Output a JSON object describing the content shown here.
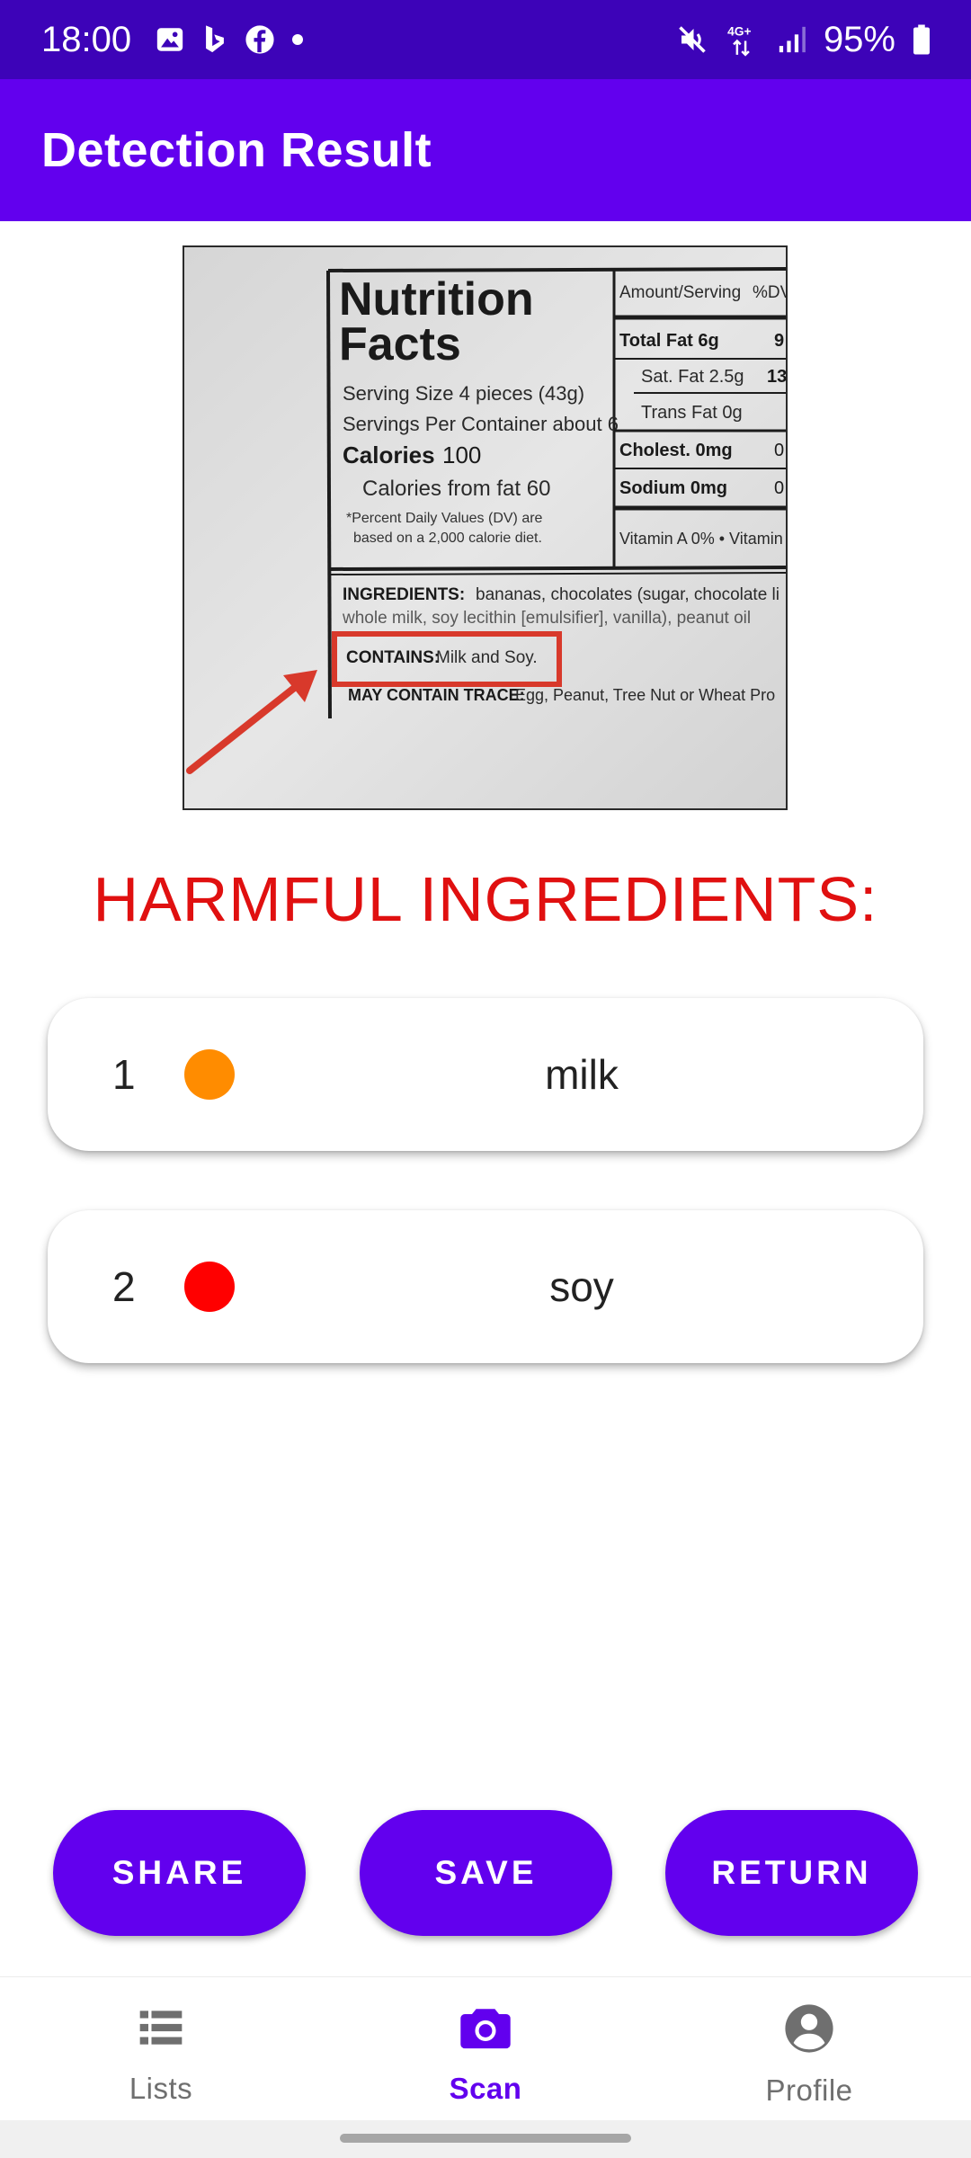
{
  "status_bar": {
    "time": "18:00",
    "battery": "95%",
    "network": "4G+",
    "left_icons": [
      "gallery-icon",
      "bing-icon",
      "facebook-icon",
      "dot-icon"
    ],
    "right_icons": [
      "mute-icon",
      "network-4g-icon",
      "signal-icon",
      "battery-icon"
    ]
  },
  "app_bar": {
    "title": "Detection Result"
  },
  "label_image": {
    "nutrition_title_1": "Nutrition",
    "nutrition_title_2": "Facts",
    "serving_size": "Serving Size 4 pieces (43g)",
    "servings_per_container": "Servings Per Container about 6",
    "calories_label": "Calories",
    "calories_value": "100",
    "calories_from_fat": "Calories from fat 60",
    "dv_note_1": "*Percent Daily Values (DV) are",
    "dv_note_2": "based on a 2,000 calorie diet.",
    "amount_per_serving": "Amount/Serving",
    "dv_header": "%DV",
    "total_fat": "Total Fat 6g",
    "total_fat_dv": "9",
    "sat_fat": "Sat. Fat 2.5g",
    "sat_fat_dv": "13",
    "trans_fat": "Trans Fat 0g",
    "cholest": "Cholest. 0mg",
    "cholest_dv": "0",
    "sodium": "Sodium 0mg",
    "sodium_dv": "0",
    "vitamin": "Vitamin A 0% • Vitamin",
    "ingredients_label": "INGREDIENTS:",
    "ingredients_text": "bananas, chocolates (sugar, chocolate li",
    "ingredients_line2": "whole milk, soy lecithin [emulsifier], vanilla), peanut oil",
    "contains_label": "CONTAINS:",
    "contains_text": "Milk and Soy.",
    "trace_label": "MAY CONTAIN TRACE:",
    "trace_text": "Egg, Peanut, Tree Nut or Wheat Pro"
  },
  "harmful_heading": "HARMFUL INGREDIENTS:",
  "ingredients": [
    {
      "index": "1",
      "name": "milk",
      "severity_color": "#ff8c00"
    },
    {
      "index": "2",
      "name": "soy",
      "severity_color": "#ff0000"
    }
  ],
  "actions": {
    "share": "SHARE",
    "save": "SAVE",
    "return": "RETURN"
  },
  "bottom_nav": {
    "items": [
      {
        "label": "Lists",
        "icon": "list-icon",
        "active": false
      },
      {
        "label": "Scan",
        "icon": "camera-icon",
        "active": true
      },
      {
        "label": "Profile",
        "icon": "account-circle-icon",
        "active": false
      }
    ]
  },
  "colors": {
    "status_bar": "#3d03b8",
    "primary": "#6200ee",
    "heading_red": "#e01010",
    "nav_inactive": "#6f6f6f"
  }
}
